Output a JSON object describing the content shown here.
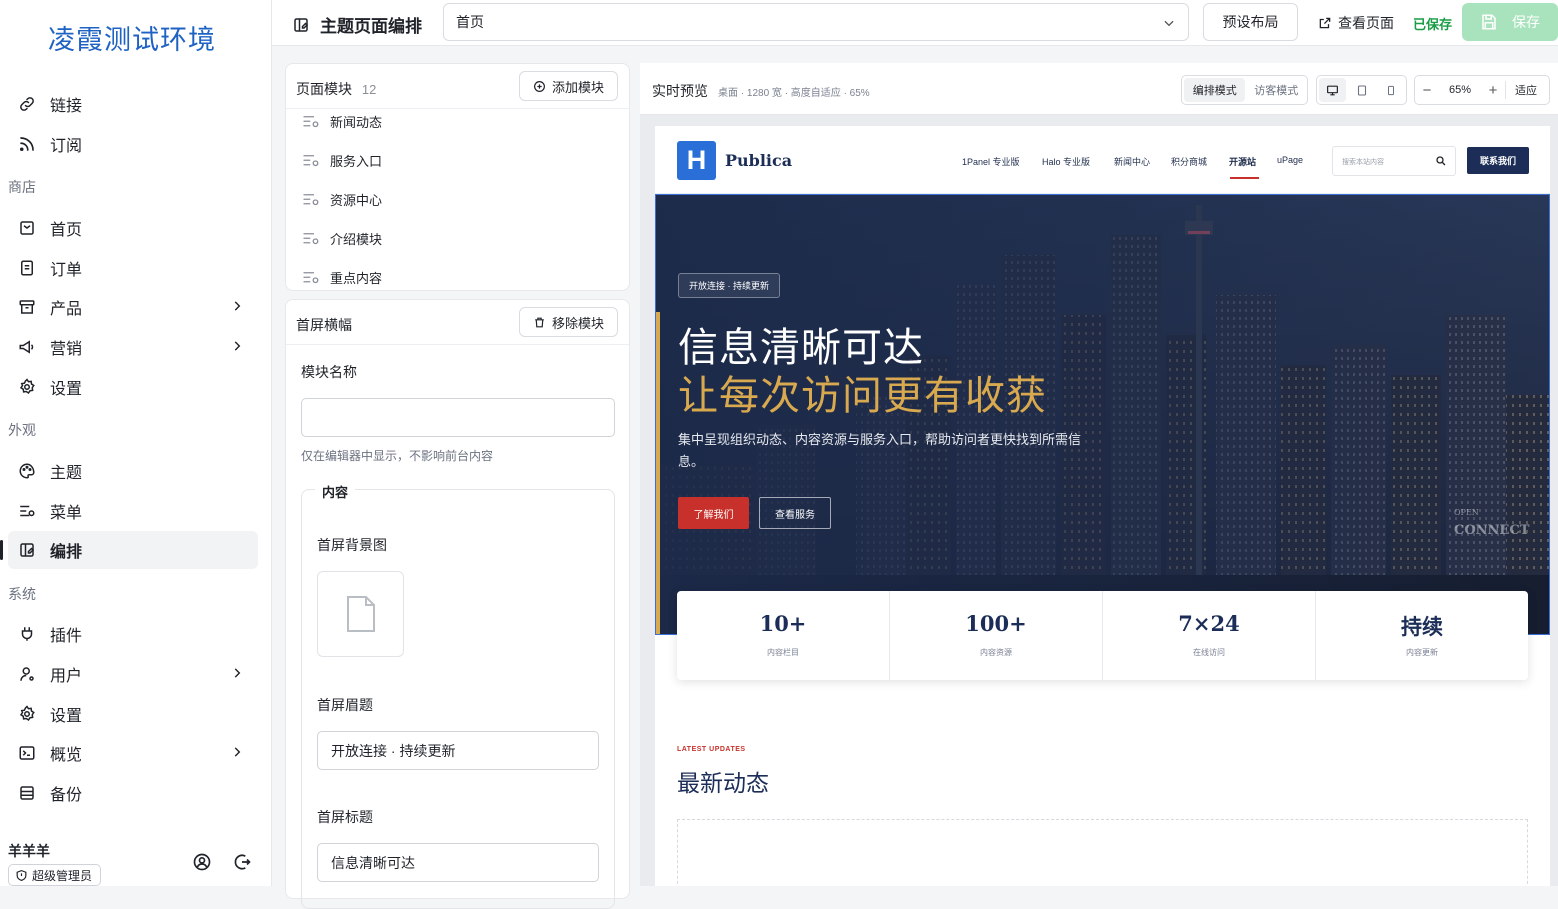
{
  "sidebar": {
    "brand": "凌霞测试环境",
    "top_items": [
      {
        "label": "链接",
        "icon": "link-icon"
      },
      {
        "label": "订阅",
        "icon": "rss-icon"
      }
    ],
    "groups": [
      {
        "title": "商店",
        "items": [
          {
            "label": "首页",
            "icon": "store-home-icon"
          },
          {
            "label": "订单",
            "icon": "receipt-icon"
          },
          {
            "label": "产品",
            "icon": "archive-icon",
            "expandable": true
          },
          {
            "label": "营销",
            "icon": "megaphone-icon",
            "expandable": true
          },
          {
            "label": "设置",
            "icon": "gear-icon"
          }
        ]
      },
      {
        "title": "外观",
        "items": [
          {
            "label": "主题",
            "icon": "palette-icon"
          },
          {
            "label": "菜单",
            "icon": "menu-settings-icon"
          },
          {
            "label": "编排",
            "icon": "layout-edit-icon",
            "active": true
          }
        ]
      },
      {
        "title": "系统",
        "items": [
          {
            "label": "插件",
            "icon": "plug-icon"
          },
          {
            "label": "用户",
            "icon": "user-icon",
            "expandable": true
          },
          {
            "label": "设置",
            "icon": "gear-icon"
          },
          {
            "label": "概览",
            "icon": "terminal-icon",
            "expandable": true
          },
          {
            "label": "备份",
            "icon": "database-icon"
          }
        ]
      }
    ],
    "user": {
      "name": "羊羊羊",
      "role": "超级管理员"
    }
  },
  "topbar": {
    "title": "主题页面编排",
    "page_select": "首页",
    "preset_layout": "预设布局",
    "view_page": "查看页面",
    "saved": "已保存",
    "save": "保存"
  },
  "modules_panel": {
    "title": "页面模块",
    "count": "12",
    "add_button": "添加模块",
    "items": [
      "新闻动态",
      "服务入口",
      "资源中心",
      "介绍模块",
      "重点内容"
    ]
  },
  "editor_panel": {
    "title": "首屏横幅",
    "remove_button": "移除模块",
    "module_name_label": "模块名称",
    "module_name_value": "",
    "module_name_hint": "仅在编辑器中显示，不影响前台内容",
    "content_legend": "内容",
    "bg_image_label": "首屏背景图",
    "eyebrow_label": "首屏眉题",
    "eyebrow_value": "开放连接 · 持续更新",
    "headline_label": "首屏标题",
    "headline_value": "信息清晰可达"
  },
  "preview": {
    "title": "实时预览",
    "meta": "桌面 · 1280 宽 · 高度自适应 · 65%",
    "modes": [
      "编排模式",
      "访客模式"
    ],
    "zoom": "65%",
    "fit": "适应",
    "site": {
      "logo_letter": "H",
      "logo_text": "Publica",
      "nav": [
        "1Panel 专业版",
        "Halo 专业版",
        "新闻中心",
        "积分商城",
        "开源站",
        "uPage"
      ],
      "active_nav": "开源站",
      "search_placeholder": "搜索本站内容",
      "contact": "联系我们",
      "hero_badge": "开放连接 · 持续更新",
      "hero_title1": "信息清晰可达",
      "hero_title2": "让每次访问更有收获",
      "hero_desc": "集中呈现组织动态、内容资源与服务入口，帮助访问者更快找到所需信息。",
      "btn_primary": "了解我们",
      "btn_secondary": "查看服务",
      "watermark_small": "OPEN",
      "watermark": "CONNECT",
      "stats": [
        {
          "num": "10+",
          "cap": "内容栏目"
        },
        {
          "num": "100+",
          "cap": "内容资源"
        },
        {
          "num": "7×24",
          "cap": "在线访问"
        },
        {
          "num": "持续",
          "cap": "内容更新"
        }
      ],
      "latest_eyebrow": "LATEST UPDATES",
      "latest_title": "最新动态"
    }
  },
  "colors": {
    "accent_green": "#1a9c46",
    "save_disabled": "#a8e3bd",
    "brand_blue": "#1e63c4",
    "site_navy": "#1c2e57",
    "hero_gold": "#d8a94e",
    "site_red": "#c8312b"
  }
}
